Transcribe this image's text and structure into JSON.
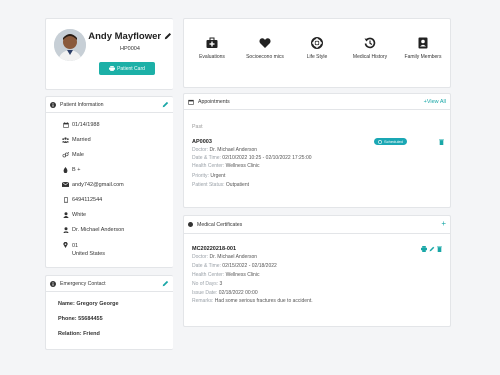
{
  "profile": {
    "name": "Andy Mayflower",
    "code": "HP0004",
    "card_button": "Patient Card"
  },
  "quick_nav": [
    {
      "label": "Evaluations",
      "icon": "briefcase-medical-icon"
    },
    {
      "label": "Socioecono mics",
      "icon": "heart-icon"
    },
    {
      "label": "Life Style",
      "icon": "lifebuoy-icon"
    },
    {
      "label": "Medical History",
      "icon": "history-icon"
    },
    {
      "label": "Family Members",
      "icon": "family-icon"
    }
  ],
  "patient_info": {
    "title": "Patient Information",
    "dob": "01/14/1988",
    "marital": "Married",
    "gender": "Male",
    "blood": "B +",
    "email": "andy742@gmail.com",
    "phone": "6494112544",
    "race": "White",
    "doctor": "Dr. Michael Anderson",
    "address_line1": "01",
    "address_line2": "United States"
  },
  "emergency": {
    "title": "Emergency Contact",
    "name_label": "Name:",
    "name": "Gregory George",
    "phone_label": "Phone:",
    "phone": "55684455",
    "relation_label": "Relation:",
    "relation": "Friend"
  },
  "appointments": {
    "title": "Appointments",
    "view_all": "View All",
    "section": "Past",
    "item": {
      "id": "AP0003",
      "status": "Scheduled",
      "doctor_label": "Doctor:",
      "doctor": "Dr. Michael Anderson",
      "datetime_label": "Date & Time:",
      "datetime": "02/10/2022 10:25 - 02/10/2022 17:25:00",
      "center_label": "Health Center:",
      "center": "Wellness Clinic",
      "priority_label": "Priority:",
      "priority": "Urgent",
      "pstatus_label": "Patient Status:",
      "pstatus": "Outpatient"
    }
  },
  "certificates": {
    "title": "Medical Certificates",
    "item": {
      "id": "MC20220218-001",
      "doctor_label": "Doctor:",
      "doctor": "Dr. Michael Anderson",
      "date_label": "Date & Time:",
      "date": "02/15/2022 - 02/18/2022",
      "center_label": "Health Center:",
      "center": "Wellness Clinic",
      "days_label": "No of Days:",
      "days": "3",
      "issue_label": "Issue Date:",
      "issue": "02/18/2022 00:00",
      "remarks_label": "Remarks:",
      "remarks": "Had some serious fractures due to accident."
    }
  },
  "colors": {
    "accent": "#19a7a7",
    "badge": "#1aa7b4",
    "danger": "#d9534f"
  }
}
